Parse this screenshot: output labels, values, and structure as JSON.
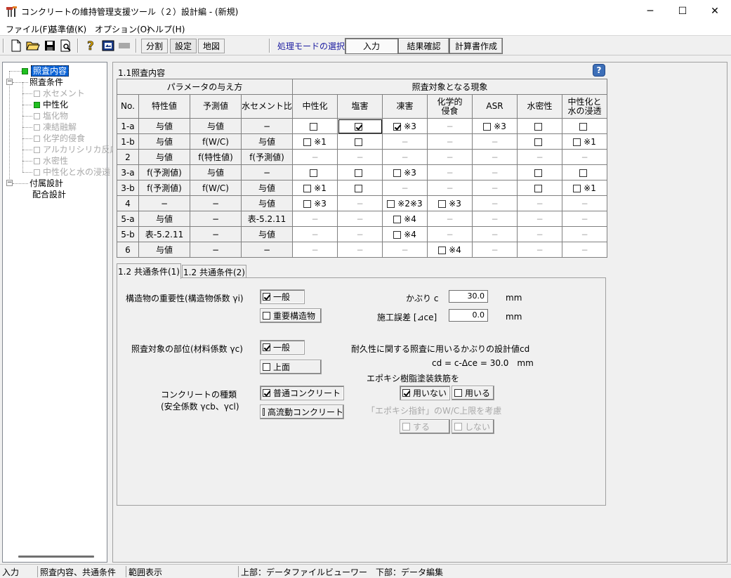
{
  "window": {
    "title": "コンクリートの維持管理支援ツール（２）設計編 - (新規)",
    "minimize": "─",
    "maximize": "☐",
    "close": "✕"
  },
  "menu": [
    "ファイル(F)",
    "基準値(K)",
    "オプション(O)",
    "ヘルプ(H)"
  ],
  "toolbar": {
    "split": "分割",
    "settings": "設定",
    "map": "地図",
    "mode_label": "処理モードの選択",
    "mode_input": "入力",
    "mode_result": "結果確認",
    "mode_report": "計算書作成"
  },
  "tree": {
    "root": "照査内容",
    "group1": "照査条件",
    "items": [
      "水セメント",
      "中性化",
      "塩化物",
      "凍結融解",
      "化学的侵食",
      "アルカリシリカ反応",
      "水密性",
      "中性化と水の浸透"
    ],
    "group2": "付属設計",
    "group2_child": "配合設計"
  },
  "section": {
    "title": "1.1照査内容",
    "help": "?"
  },
  "table": {
    "group_param": "パラメータの与え方",
    "group_phen": "照査対象となる現象",
    "headers": [
      "No.",
      "特性値",
      "予測値",
      "水セメント比",
      "中性化",
      "塩害",
      "凍害",
      "化学的\n侵食",
      "ASR",
      "水密性",
      "中性化と\n水の浸透"
    ],
    "rows": [
      {
        "no": "1-a",
        "c1": "与値",
        "c2": "与値",
        "c3": "−",
        "p": [
          "cb",
          "cb-on-sel",
          "cb-on:※3",
          "-",
          "cb:※3",
          "cb",
          "cb"
        ]
      },
      {
        "no": "1-b",
        "c1": "与値",
        "c2": "f(W/C)",
        "c3": "与値",
        "p": [
          "cb:※1",
          "cb",
          "-",
          "-",
          "-",
          "cb",
          "cb:※1"
        ]
      },
      {
        "no": "2",
        "c1": "与値",
        "c2": "f(特性値)",
        "c3": "f(予測値)",
        "p": [
          "-",
          "-",
          "-",
          "-",
          "-",
          "-",
          "-"
        ]
      },
      {
        "no": "3-a",
        "c1": "f(予測値)",
        "c2": "与値",
        "c3": "−",
        "p": [
          "cb",
          "cb",
          "cb:※3",
          "-",
          "-",
          "cb",
          "cb"
        ]
      },
      {
        "no": "3-b",
        "c1": "f(予測値)",
        "c2": "f(W/C)",
        "c3": "与値",
        "p": [
          "cb:※1",
          "cb",
          "-",
          "-",
          "-",
          "cb",
          "cb:※1"
        ]
      },
      {
        "no": "4",
        "c1": "−",
        "c2": "−",
        "c3": "与値",
        "p": [
          "cb:※3",
          "-",
          "cb:※2※3",
          "cb:※3",
          "-",
          "-",
          "-"
        ]
      },
      {
        "no": "5-a",
        "c1": "与値",
        "c2": "−",
        "c3": "表-5.2.11",
        "p": [
          "-",
          "-",
          "cb:※4",
          "-",
          "-",
          "-",
          "-"
        ]
      },
      {
        "no": "5-b",
        "c1": "表-5.2.11",
        "c2": "−",
        "c3": "与値",
        "p": [
          "-",
          "-",
          "cb:※4",
          "-",
          "-",
          "-",
          "-"
        ]
      },
      {
        "no": "6",
        "c1": "与値",
        "c2": "−",
        "c3": "−",
        "p": [
          "-",
          "-",
          "-",
          "cb:※4",
          "-",
          "-",
          "-"
        ]
      }
    ],
    "dash": "−"
  },
  "tabs": [
    "1.2 共通条件(1)",
    "1.2 共通条件(2)"
  ],
  "form": {
    "importance_label": "構造物の重要性(構造物係数 γi)",
    "importance_general": "一般",
    "importance_important": "重要構造物",
    "cover_label": "かぶり c",
    "cover_value": "30.0",
    "cover_unit": "mm",
    "error_label": "施工誤差 [⊿ce]",
    "error_value": "0.0",
    "error_unit": "mm",
    "part_label": "照査対象の部位(材料係数 γc)",
    "part_general": "一般",
    "part_top": "上面",
    "design_cover_label": "耐久性に関する照査に用いるかぶりの設計値cd",
    "design_cover_formula": "cd = c-Δce = 30.0　mm",
    "epoxy_label": "エポキシ樹脂塗装鉄筋を",
    "epoxy_no": "用いない",
    "epoxy_yes": "用いる",
    "epoxy_guide_label": "「エポキシ指針」のW/C上限を考慮",
    "guide_yes": "する",
    "guide_no": "しない",
    "concrete_label": "コンクリートの種類",
    "concrete_sub": "(安全係数 γcb、γcl)",
    "concrete_normal": "普通コンクリート",
    "concrete_high": "高流動コンクリート"
  },
  "status": [
    "入力",
    "照査内容、共通条件",
    "範囲表示",
    "上部：データファイルビューワー　下部：データ編集"
  ]
}
